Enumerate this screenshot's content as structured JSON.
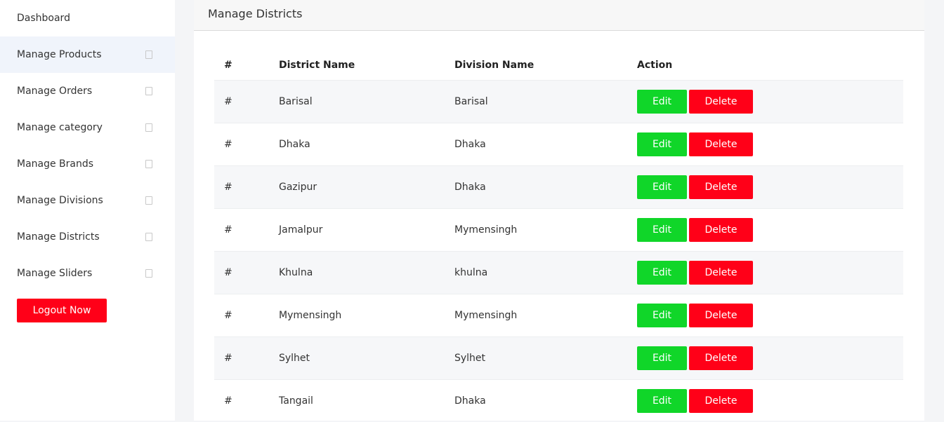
{
  "sidebar": {
    "items": [
      {
        "label": "Dashboard",
        "has_caret": false
      },
      {
        "label": "Manage Products",
        "has_caret": true,
        "active": true
      },
      {
        "label": "Manage Orders",
        "has_caret": true
      },
      {
        "label": "Manage category",
        "has_caret": true
      },
      {
        "label": "Manage Brands",
        "has_caret": true
      },
      {
        "label": "Manage Divisions",
        "has_caret": true
      },
      {
        "label": "Manage Districts",
        "has_caret": true
      },
      {
        "label": "Manage Sliders",
        "has_caret": true
      }
    ],
    "logout_label": "Logout Now"
  },
  "main": {
    "title": "Manage Districts",
    "table": {
      "headers": {
        "index": "#",
        "district": "District Name",
        "division": "Division Name",
        "action": "Action"
      },
      "rows": [
        {
          "index": "#",
          "district": "Barisal",
          "division": "Barisal"
        },
        {
          "index": "#",
          "district": "Dhaka",
          "division": "Dhaka"
        },
        {
          "index": "#",
          "district": "Gazipur",
          "division": "Dhaka"
        },
        {
          "index": "#",
          "district": "Jamalpur",
          "division": "Mymensingh"
        },
        {
          "index": "#",
          "district": "Khulna",
          "division": "khulna"
        },
        {
          "index": "#",
          "district": "Mymensingh",
          "division": "Mymensingh"
        },
        {
          "index": "#",
          "district": "Sylhet",
          "division": "Sylhet"
        },
        {
          "index": "#",
          "district": "Tangail",
          "division": "Dhaka"
        }
      ],
      "edit_label": "Edit",
      "delete_label": "Delete"
    }
  },
  "colors": {
    "edit": "#10d629",
    "delete": "#ff0018",
    "active_nav": "#f0f4fb"
  }
}
